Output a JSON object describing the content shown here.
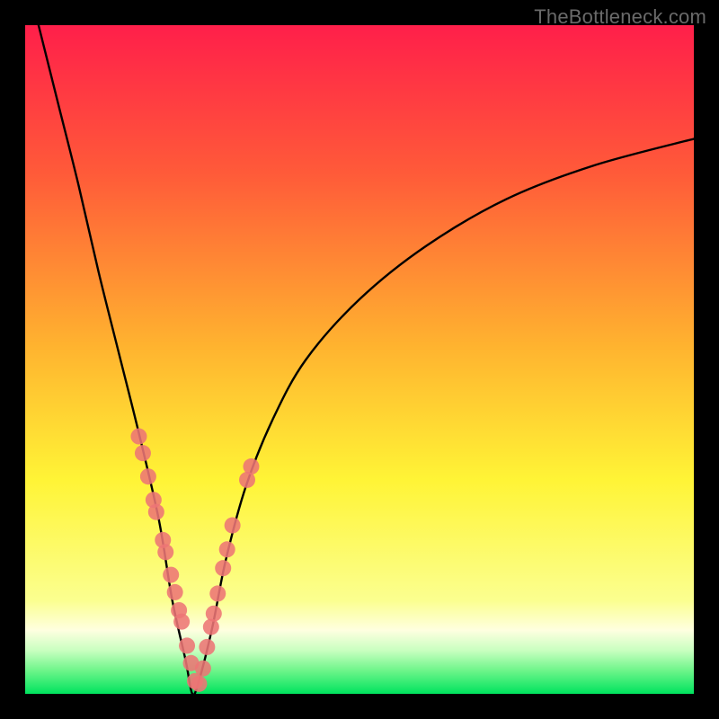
{
  "watermark": "TheBottleneck.com",
  "colors": {
    "frame": "#000000",
    "curve": "#000000",
    "dot_fill": "#ed7575",
    "dot_stroke": "#ed7575",
    "grad_top": "#ff1f4a",
    "grad_mid1": "#ff6a2f",
    "grad_mid2": "#ffd230",
    "grad_yellow": "#fff33a",
    "grad_pale": "#fdffc2",
    "grad_green1": "#9ff7a0",
    "grad_green2": "#00e35e"
  },
  "chart_data": {
    "type": "line",
    "title": "",
    "xlabel": "",
    "ylabel": "",
    "xlim": [
      0,
      100
    ],
    "ylim": [
      0,
      100
    ],
    "note": "Axes have no tick labels; values are relative percentages read from position. The curve depicts a bottleneck metric that drops to ~0 near x≈25 then rises.",
    "series": [
      {
        "name": "bottleneck-curve",
        "x": [
          2,
          5,
          8,
          11,
          14,
          17,
          20,
          22,
          24,
          25,
          26,
          28,
          30,
          33,
          37,
          42,
          50,
          60,
          72,
          85,
          100
        ],
        "y": [
          100,
          88,
          76,
          63,
          51,
          39,
          26,
          14,
          5,
          0,
          2,
          10,
          20,
          31,
          41,
          50,
          59,
          67,
          74,
          79,
          83
        ]
      }
    ],
    "scatter": [
      {
        "name": "highlight-dots",
        "x": [
          17.0,
          17.6,
          18.4,
          19.2,
          19.6,
          20.6,
          21.0,
          21.8,
          22.4,
          23.0,
          23.4,
          24.2,
          24.8,
          25.4,
          26.0,
          26.6,
          27.2,
          27.8,
          28.2,
          28.8,
          29.6,
          30.2,
          31.0,
          33.2,
          33.8
        ],
        "y": [
          38.5,
          36.0,
          32.5,
          29.0,
          27.2,
          23.0,
          21.2,
          17.8,
          15.2,
          12.5,
          10.8,
          7.2,
          4.6,
          1.9,
          1.5,
          3.8,
          7.0,
          10.0,
          12.0,
          15.0,
          18.8,
          21.6,
          25.2,
          32.0,
          34.0
        ]
      }
    ],
    "background_gradient": {
      "stops": [
        {
          "offset": 0.0,
          "color": "#ff1f4a"
        },
        {
          "offset": 0.22,
          "color": "#ff5a39"
        },
        {
          "offset": 0.48,
          "color": "#ffb32f"
        },
        {
          "offset": 0.68,
          "color": "#fff436"
        },
        {
          "offset": 0.86,
          "color": "#fbff8f"
        },
        {
          "offset": 0.905,
          "color": "#feffe0"
        },
        {
          "offset": 0.935,
          "color": "#c9ffc0"
        },
        {
          "offset": 0.965,
          "color": "#6ef58a"
        },
        {
          "offset": 1.0,
          "color": "#00e35e"
        }
      ]
    }
  }
}
